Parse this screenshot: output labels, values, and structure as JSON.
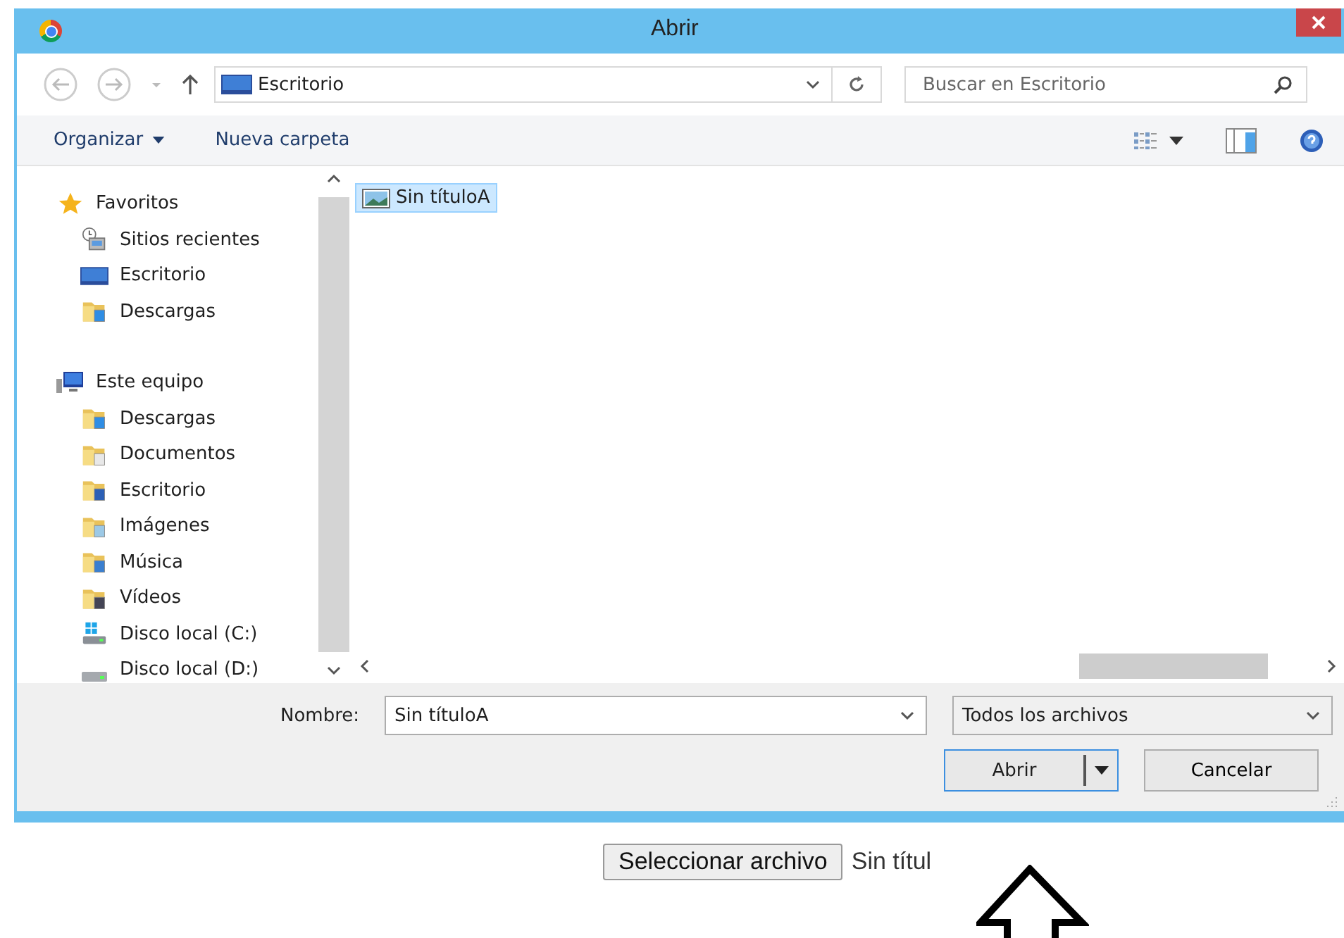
{
  "window": {
    "title": "Abrir"
  },
  "nav": {
    "address": "Escritorio",
    "search": {
      "placeholder": "Buscar en Escritorio"
    }
  },
  "toolbar": {
    "organize": "Organizar",
    "new_folder": "Nueva carpeta"
  },
  "sidebar": {
    "items": [
      {
        "label": "Favoritos",
        "kind": "star",
        "children": [
          {
            "label": "Sitios recientes",
            "kind": "recent"
          },
          {
            "label": "Escritorio",
            "kind": "desktop"
          },
          {
            "label": "Descargas",
            "kind": "download-folder"
          }
        ]
      },
      {
        "label": "Este equipo",
        "kind": "pc",
        "children": [
          {
            "label": "Descargas",
            "kind": "download-folder"
          },
          {
            "label": "Documentos",
            "kind": "docs-folder"
          },
          {
            "label": "Escritorio",
            "kind": "desktop-folder"
          },
          {
            "label": "Imágenes",
            "kind": "pictures-folder"
          },
          {
            "label": "Música",
            "kind": "music-folder"
          },
          {
            "label": "Vídeos",
            "kind": "video-folder"
          },
          {
            "label": "Disco local (C:)",
            "kind": "system-drive"
          },
          {
            "label": "Disco local (D:)",
            "kind": "drive"
          }
        ]
      }
    ]
  },
  "files": [
    {
      "name": "Sin títuloA",
      "selected": true
    }
  ],
  "bottom": {
    "name_label": "Nombre:",
    "name_value": "Sin títuloA",
    "filter": "Todos los archivos",
    "open": "Abrir",
    "cancel": "Cancelar"
  },
  "page": {
    "choose_button": "Seleccionar archivo",
    "chosen_file": "Sin títul"
  }
}
